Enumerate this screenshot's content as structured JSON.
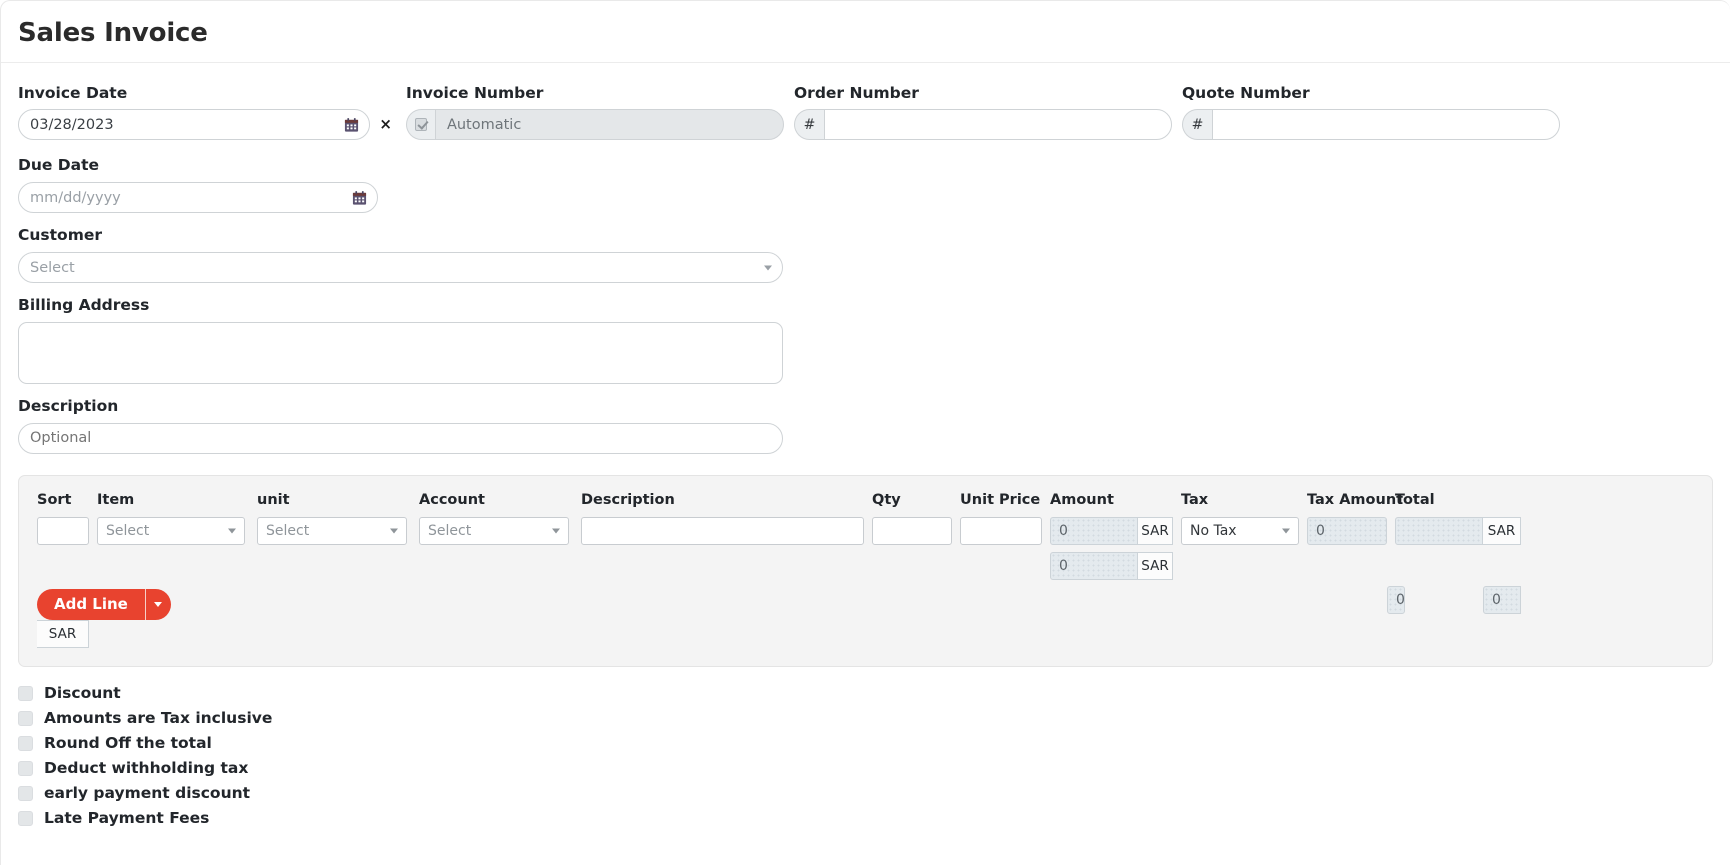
{
  "page": {
    "title": "Sales Invoice"
  },
  "form": {
    "invoice_date": {
      "label": "Invoice Date",
      "value": "03/28/2023",
      "icon": "calendar-icon",
      "clear_label": "×"
    },
    "invoice_number": {
      "label": "Invoice Number",
      "value": "Automatic",
      "checkbox_checked": true,
      "disabled": true
    },
    "order_number": {
      "label": "Order Number",
      "prefix": "#",
      "value": "",
      "placeholder": ""
    },
    "quote_number": {
      "label": "Quote Number",
      "prefix": "#",
      "value": "",
      "placeholder": ""
    },
    "due_date": {
      "label": "Due Date",
      "value": "",
      "placeholder": "mm/dd/yyyy",
      "icon": "calendar-icon"
    },
    "customer": {
      "label": "Customer",
      "value": "Select"
    },
    "billing_address": {
      "label": "Billing Address",
      "value": "",
      "placeholder": ""
    },
    "description": {
      "label": "Description",
      "value": "",
      "placeholder": "Optional"
    }
  },
  "lines": {
    "headers": {
      "sort": "Sort",
      "item": "Item",
      "unit": "unit",
      "account": "Account",
      "description": "Description",
      "qty": "Qty",
      "unit_price": "Unit Price",
      "amount": "Amount",
      "tax": "Tax",
      "tax_amount": "Tax Amount",
      "total": "Total"
    },
    "row": {
      "sort": "",
      "item": "Select",
      "unit": "Select",
      "account": "Select",
      "description": "",
      "qty": "",
      "unit_price": "",
      "amount": "0",
      "amount_currency": "SAR",
      "tax": "No Tax",
      "tax_amount": "0",
      "total": "",
      "total_currency": "SAR"
    },
    "totals": {
      "amount": "0",
      "amount_currency": "SAR",
      "tax_amount": "0",
      "total": "0",
      "total_currency": "SAR"
    },
    "add_line_label": "Add Line"
  },
  "options": [
    {
      "label": "Discount",
      "checked": false
    },
    {
      "label": "Amounts are Tax inclusive",
      "checked": false
    },
    {
      "label": "Round Off the total",
      "checked": false
    },
    {
      "label": "Deduct withholding tax",
      "checked": false
    },
    {
      "label": "early payment discount",
      "checked": false
    },
    {
      "label": "Late Payment Fees",
      "checked": false
    }
  ],
  "colors": {
    "accent": "#e8432f",
    "panel": "#f4f4f4",
    "text": "#22262b",
    "placeholder": "#9aa0a6",
    "readonly_bg": "#e4eaee"
  }
}
